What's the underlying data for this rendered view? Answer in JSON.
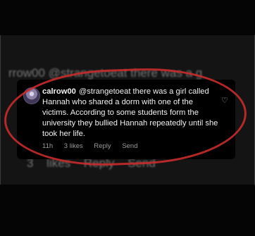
{
  "background_text": {
    "top": "rrow00 @strangetoeat there was a g",
    "bottom": "3 likes Reply Send"
  },
  "comment": {
    "username": "calrow00",
    "text": "@strangetoeat there was a girl called Hannah who shared a dorm with one of the victims. According to some students form the university they bullied Hannah repeatedly until she took her life.",
    "time": "11h",
    "likes": "3 likes",
    "reply_label": "Reply",
    "send_label": "Send",
    "like_icon": "heart-outline-icon"
  },
  "annotation_color": "#c92b2b"
}
